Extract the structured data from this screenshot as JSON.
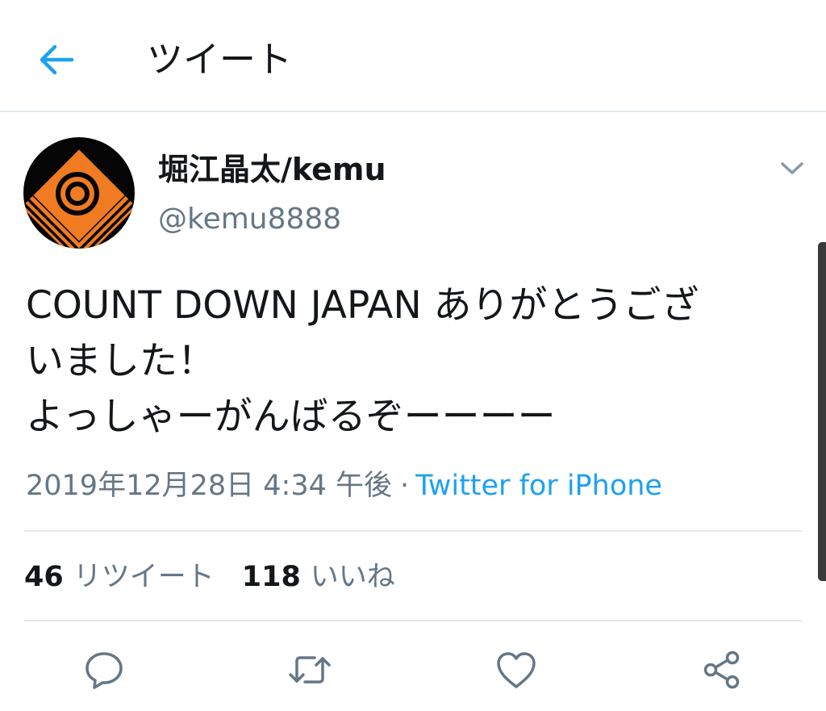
{
  "header": {
    "title": "ツイート",
    "back_icon": "arrow-left-icon"
  },
  "tweet": {
    "display_name": "堀江晶太/kemu",
    "handle": "@kemu8888",
    "text_lines": [
      "COUNT DOWN JAPAN ありがとうござ",
      "いました！",
      "よっしゃーがんばるぞーーーー"
    ],
    "date": "2019年12月28日 4:34 午後",
    "separator": "·",
    "source": "Twitter for iPhone",
    "retweet_count": "46",
    "retweet_label": "リツイート",
    "like_count": "118",
    "like_label": "いいね"
  },
  "actions": {
    "reply": "reply-icon",
    "retweet": "retweet-icon",
    "like": "heart-icon",
    "share": "share-icon"
  },
  "colors": {
    "accent": "#1da1f2",
    "secondary_text": "#657786",
    "primary_text": "#14171a",
    "divider": "#e1e8ed",
    "avatar_bg": "#050505",
    "avatar_logo": "#f07b22"
  }
}
